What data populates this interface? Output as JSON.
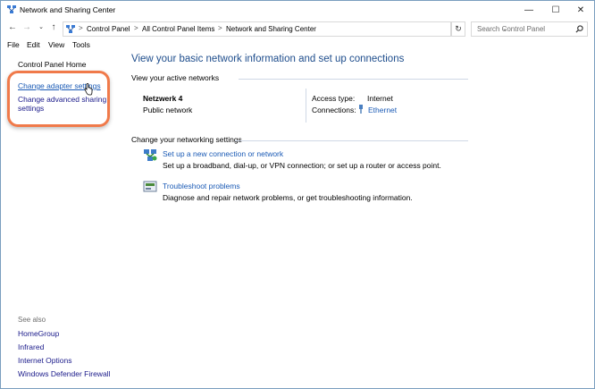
{
  "window": {
    "title": "Network and Sharing Center",
    "controls": {
      "minimize": "—",
      "maximize": "☐",
      "close": "✕"
    }
  },
  "address_bar": {
    "breadcrumbs": [
      "Control Panel",
      "All Control Panel Items",
      "Network and Sharing Center"
    ],
    "separator": ">",
    "search_placeholder": "Search Control Panel"
  },
  "menu": [
    "File",
    "Edit",
    "View",
    "Tools"
  ],
  "sidebar": {
    "home": "Control Panel Home",
    "links": [
      "Change adapter settings",
      "Change advanced sharing",
      "settings"
    ],
    "see_also_title": "See also",
    "see_also": [
      "HomeGroup",
      "Infrared",
      "Internet Options",
      "Windows Defender Firewall"
    ]
  },
  "main": {
    "title": "View your basic network information and set up connections",
    "active_networks_label": "View your active networks",
    "network": {
      "name": "Netzwerk  4",
      "type": "Public network",
      "access_type_label": "Access type:",
      "access_type": "Internet",
      "connections_label": "Connections:",
      "connection": "Ethernet"
    },
    "change_settings_label": "Change your networking settings",
    "tasks": [
      {
        "link": "Set up a new connection or network",
        "desc": "Set up a broadband, dial-up, or VPN connection; or set up a router or access point."
      },
      {
        "link": "Troubleshoot problems",
        "desc": "Diagnose and repair network problems, or get troubleshooting information."
      }
    ]
  },
  "colors": {
    "accent": "#1e4d8c",
    "link": "#1a5ab5",
    "highlight": "#f07a4a"
  }
}
